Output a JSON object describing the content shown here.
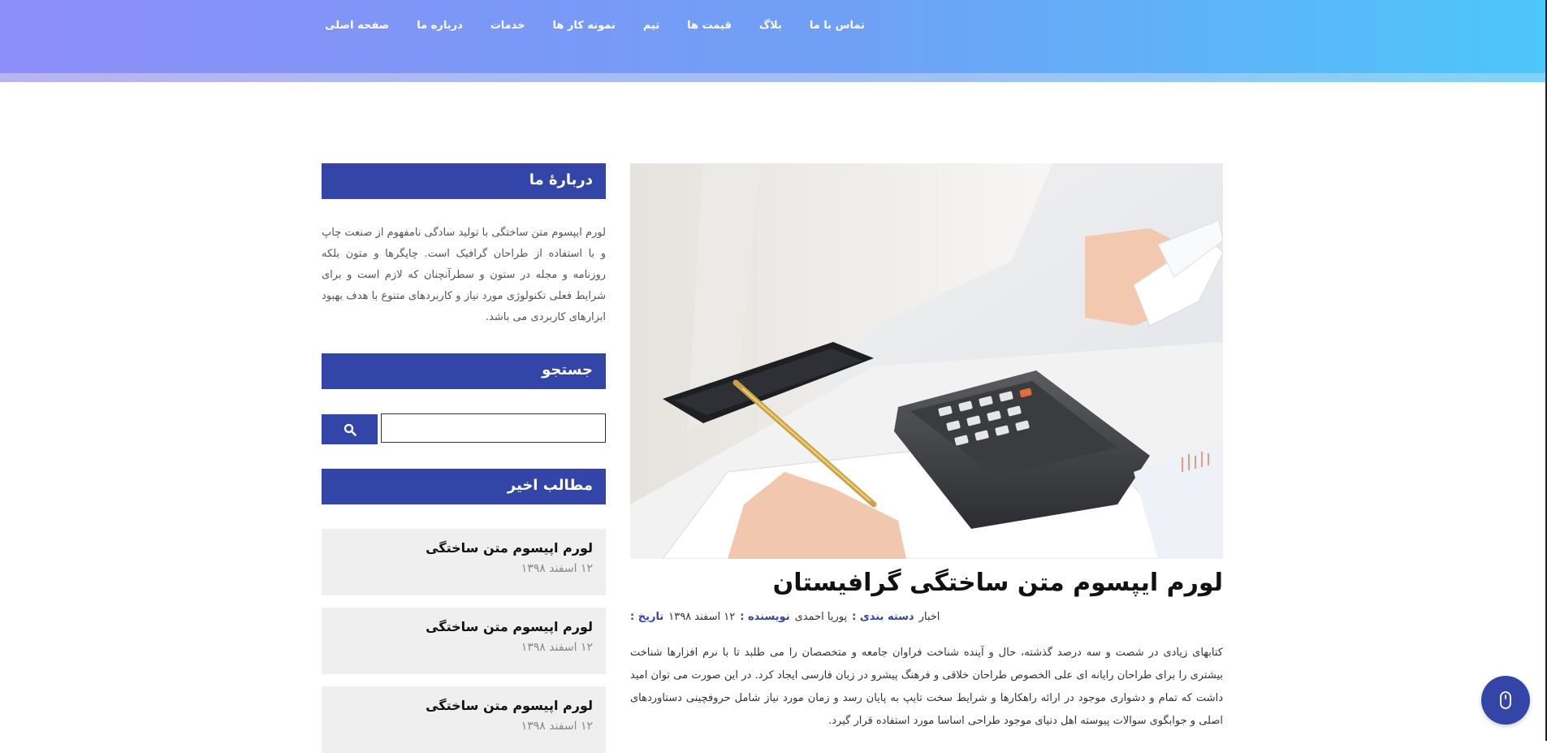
{
  "nav": {
    "items": [
      {
        "label": "صفحه اصلی"
      },
      {
        "label": "درباره ما"
      },
      {
        "label": "خدمات"
      },
      {
        "label": "نمونه کار ها"
      },
      {
        "label": "تیم"
      },
      {
        "label": "قیمت ها"
      },
      {
        "label": "بلاگ"
      },
      {
        "label": "تماس با ما"
      }
    ]
  },
  "post": {
    "title": "لورم ایپسوم متن ساختگی گرافیستان",
    "meta": {
      "date_label": "تاریخ :",
      "date_value": "۱۲ اسفند ۱۳۹۸",
      "author_label": "نویسنده :",
      "author_value": "پوریا احمدی",
      "category_label": "دسته بندی :",
      "category_value": "اخبار"
    },
    "excerpt": "کتابهای زیادی در شصت و سه درصد گذشته، حال و آینده شناخت فراوان جامعه و متخصصان را می طلبد تا با نرم افزارها شناخت بیشتری را برای طراحان رایانه ای علی الخصوص طراحان خلاقی و فرهنگ پیشرو در زبان فارسی ایجاد کرد. در این صورت می توان امید داشت که تمام و دشواری موجود در ارائه راهکارها و شرایط سخت تایپ به پایان رسد و زمان مورد نیاز شامل حروفچینی دستاوردهای اصلی و جوابگوی سوالات پیوسته اهل دنیای موجود طراحی اساسا مورد استفاده قرار گیرد."
  },
  "sidebar": {
    "about": {
      "title": "دربارهٔ ما",
      "text": "لورم ایپسوم متن ساختگی با تولید سادگی نامفهوم از صنعت چاپ و با استفاده از طراحان گرافیک است. چاپگرها و متون بلکه روزنامه و مجله در ستون و سطرآنچنان که لازم است و برای شرایط فعلی تکنولوژی مورد نیاز و کاربردهای متنوع با هدف بهبود ابزارهای کاربردی می باشد."
    },
    "search": {
      "title": "جستجو",
      "value": "",
      "placeholder": ""
    },
    "recent": {
      "title": "مطالب اخیر",
      "items": [
        {
          "title": "لورم اپیسوم متن ساختگی",
          "date": "۱۲ اسفند ۱۳۹۸"
        },
        {
          "title": "لورم اپیسوم متن ساختگی",
          "date": "۱۲ اسفند ۱۳۹۸"
        },
        {
          "title": "لورم اپیسوم متن ساختگی",
          "date": "۱۲ اسفند ۱۳۹۸"
        }
      ]
    }
  },
  "icons": {
    "search": "search-icon",
    "scroll_top": "mouse-scroll-icon"
  },
  "colors": {
    "accent": "#3346a8",
    "header_start": "#8d8df8",
    "header_end": "#4dc6fa"
  }
}
